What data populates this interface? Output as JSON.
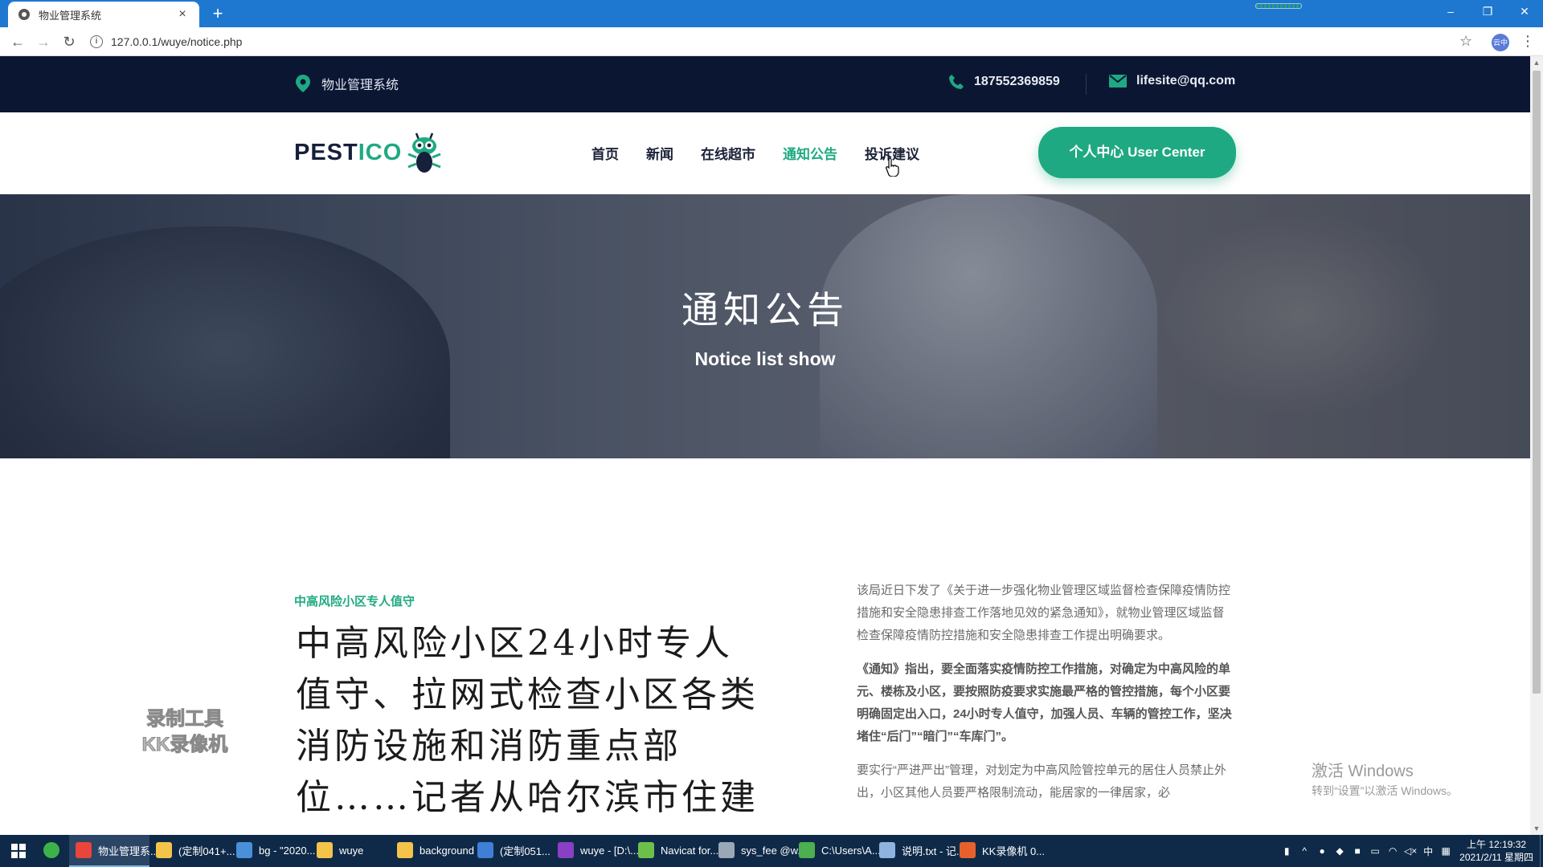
{
  "browser": {
    "tab_title": "物业管理系统",
    "tab_close": "×",
    "new_tab": "+",
    "url": "127.0.0.1/wuye/notice.php",
    "profile_label": "云中",
    "window_minimize": "–",
    "window_restore": "❐",
    "window_close": "✕"
  },
  "topbar": {
    "site_name": "物业管理系统",
    "phone": "187552369859",
    "email": "lifesite@qq.com"
  },
  "header": {
    "logo_main": "PEST",
    "logo_accent": "ICO",
    "nav": [
      "首页",
      "新闻",
      "在线超市",
      "通知公告",
      "投诉建议"
    ],
    "active_nav": "通知公告",
    "user_center": "个人中心 User Center"
  },
  "hero": {
    "title": "通知公告",
    "subtitle": "Notice list show"
  },
  "article": {
    "tagline": "中高风险小区专人值守",
    "headline": "中高风险小区24小时专人值守、拉网式检查小区各类消防设施和消防重点部位……记者从哈尔滨市住建",
    "paragraphs": [
      "该局近日下发了《关于进一步强化物业管理区域监督检查保障疫情防控措施和安全隐患排查工作落地见效的紧急通知》，就物业管理区域监督检查保障疫情防控措施和安全隐患排查工作提出明确要求。",
      "《通知》指出，要全面落实疫情防控工作措施，对确定为中高风险的单元、楼栋及小区，要按照防疫要求实施最严格的管控措施，每个小区要明确固定出入口，24小时专人值守，加强人员、车辆的管控工作，坚决堵住“后门”“暗门”“车库门”。",
      "要实行“严进严出”管理，对划定为中高风险管控单元的居住人员禁止外出，小区其他人员要严格限制流动，能居家的一律居家，必"
    ]
  },
  "watermarks": {
    "kk_line1": "录制工具",
    "kk_line2": "KK录像机",
    "activate_title": "激活 Windows",
    "activate_sub": "转到“设置”以激活 Windows。"
  },
  "taskbar": {
    "apps": [
      {
        "label": "",
        "color": "#3cb34a"
      },
      {
        "label": "物业管理系...",
        "color": "#e8453c",
        "active": true
      },
      {
        "label": "(定制041+...",
        "color": "#f3c34a"
      },
      {
        "label": "bg - \"2020...",
        "color": "#4a90d9"
      },
      {
        "label": "wuye",
        "color": "#f3c34a"
      },
      {
        "label": "background",
        "color": "#f3c34a"
      },
      {
        "label": "(定制051...",
        "color": "#3f7fd6"
      },
      {
        "label": "wuye - [D:\\...",
        "color": "#8a3fc4"
      },
      {
        "label": "Navicat for...",
        "color": "#6cc04a"
      },
      {
        "label": "sys_fee @w...",
        "color": "#9aa7b5"
      },
      {
        "label": "C:\\Users\\A...",
        "color": "#4caf50"
      },
      {
        "label": "说明.txt - 记...",
        "color": "#8fb3e0"
      },
      {
        "label": "KK录像机 0...",
        "color": "#e8612c"
      }
    ],
    "ime": "中",
    "time": "上午 12:19:32",
    "date": "2021/2/11 星期四"
  },
  "colors": {
    "accent": "#1fa982",
    "topbar_bg": "#0b1633",
    "titlebar_bg": "#1f78d0",
    "taskbar_bg": "#0f2a48"
  }
}
